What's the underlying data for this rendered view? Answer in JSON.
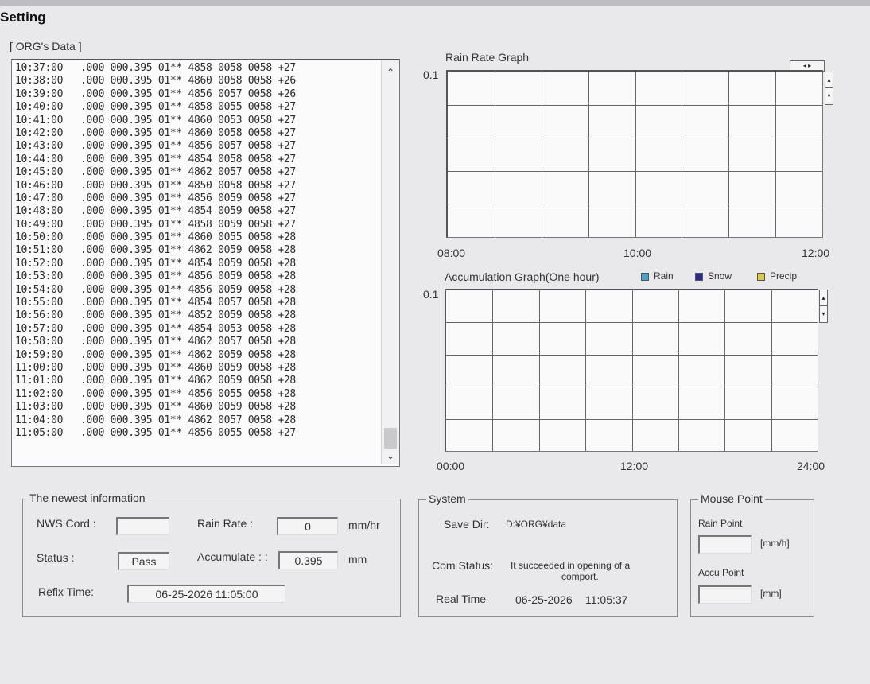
{
  "window": {
    "title": "Setting"
  },
  "data_panel": {
    "label": "[ ORG's Data ]",
    "rows": [
      {
        "time": "10:37:00",
        "values": ".000 000.395 01** 4858 0058 0058 +27"
      },
      {
        "time": "10:38:00",
        "values": ".000 000.395 01** 4860 0058 0058 +26"
      },
      {
        "time": "10:39:00",
        "values": ".000 000.395 01** 4856 0057 0058 +26"
      },
      {
        "time": "10:40:00",
        "values": ".000 000.395 01** 4858 0055 0058 +27"
      },
      {
        "time": "10:41:00",
        "values": ".000 000.395 01** 4860 0053 0058 +27"
      },
      {
        "time": "10:42:00",
        "values": ".000 000.395 01** 4860 0058 0058 +27"
      },
      {
        "time": "10:43:00",
        "values": ".000 000.395 01** 4856 0057 0058 +27"
      },
      {
        "time": "10:44:00",
        "values": ".000 000.395 01** 4854 0058 0058 +27"
      },
      {
        "time": "10:45:00",
        "values": ".000 000.395 01** 4862 0057 0058 +27"
      },
      {
        "time": "10:46:00",
        "values": ".000 000.395 01** 4850 0058 0058 +27"
      },
      {
        "time": "10:47:00",
        "values": ".000 000.395 01** 4856 0059 0058 +27"
      },
      {
        "time": "10:48:00",
        "values": ".000 000.395 01** 4854 0059 0058 +27"
      },
      {
        "time": "10:49:00",
        "values": ".000 000.395 01** 4858 0059 0058 +27"
      },
      {
        "time": "10:50:00",
        "values": ".000 000.395 01** 4860 0055 0058 +28"
      },
      {
        "time": "10:51:00",
        "values": ".000 000.395 01** 4862 0059 0058 +28"
      },
      {
        "time": "10:52:00",
        "values": ".000 000.395 01** 4854 0059 0058 +28"
      },
      {
        "time": "10:53:00",
        "values": ".000 000.395 01** 4856 0059 0058 +28"
      },
      {
        "time": "10:54:00",
        "values": ".000 000.395 01** 4856 0059 0058 +28"
      },
      {
        "time": "10:55:00",
        "values": ".000 000.395 01** 4854 0057 0058 +28"
      },
      {
        "time": "10:56:00",
        "values": ".000 000.395 01** 4852 0059 0058 +28"
      },
      {
        "time": "10:57:00",
        "values": ".000 000.395 01** 4854 0053 0058 +28"
      },
      {
        "time": "10:58:00",
        "values": ".000 000.395 01** 4862 0057 0058 +28"
      },
      {
        "time": "10:59:00",
        "values": ".000 000.395 01** 4862 0059 0058 +28"
      },
      {
        "time": "11:00:00",
        "values": ".000 000.395 01** 4860 0059 0058 +28"
      },
      {
        "time": "11:01:00",
        "values": ".000 000.395 01** 4862 0059 0058 +28"
      },
      {
        "time": "11:02:00",
        "values": ".000 000.395 01** 4856 0055 0058 +28"
      },
      {
        "time": "11:03:00",
        "values": ".000 000.395 01** 4860 0059 0058 +28"
      },
      {
        "time": "11:04:00",
        "values": ".000 000.395 01** 4862 0057 0058 +28"
      },
      {
        "time": "11:05:00",
        "values": ".000 000.395 01** 4856 0055 0058 +27"
      }
    ],
    "scroll_up_icon": "chevron-up-icon",
    "scroll_down_icon": "chevron-down-icon"
  },
  "rain_rate_graph": {
    "title": "Rain Rate Graph",
    "y_max_label": "0.1",
    "x_labels": [
      "08:00",
      "10:00",
      "12:00"
    ]
  },
  "accumulation_graph": {
    "title": "Accumulation Graph(One hour)",
    "y_max_label": "0.1",
    "x_labels": [
      "00:00",
      "12:00",
      "24:00"
    ],
    "legend": [
      {
        "label": "Rain",
        "color": "#4aa3c9"
      },
      {
        "label": "Snow",
        "color": "#2a2a8a"
      },
      {
        "label": "Precip",
        "color": "#d9c94a"
      }
    ]
  },
  "newest_info": {
    "legend": "The newest information",
    "nws_cord_label": "NWS Cord :",
    "nws_cord_value": "",
    "rain_rate_label": "Rain Rate :",
    "rain_rate_value": "0",
    "rain_rate_unit": "mm/hr",
    "status_label": "Status    :",
    "status_value": "Pass",
    "accumulate_label": "Accumulate : :",
    "accumulate_value": "0.395",
    "accumulate_unit": "mm",
    "refix_time_label": "Refix Time:",
    "refix_time_value": "06-25-2026 11:05:00"
  },
  "system": {
    "legend": "System",
    "save_dir_label": "Save Dir:",
    "save_dir_value": "D:¥ORG¥data",
    "com_status_label": "Com Status:",
    "com_status_value_line1": "It succeeded in opening of a",
    "com_status_value_line2": "comport.",
    "real_time_label": "Real Time",
    "real_time_date": "06-25-2026",
    "real_time_clock": "11:05:37"
  },
  "mouse_point": {
    "legend": "Mouse Point",
    "rain_point_label": "Rain Point",
    "rain_point_value": "",
    "rain_point_unit": "[mm/h]",
    "accu_point_label": "Accu Point",
    "accu_point_value": "",
    "accu_point_unit": "[mm]"
  }
}
